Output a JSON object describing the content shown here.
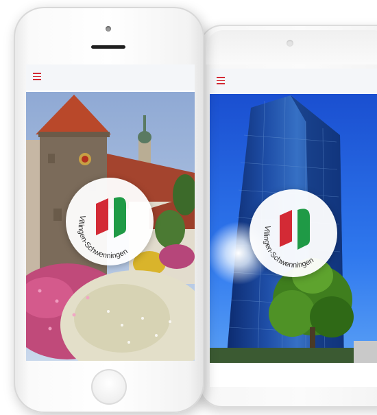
{
  "brand": {
    "logo_text": "Villingen-Schwenningen",
    "colors": {
      "red": "#d32a35",
      "green": "#1f9a46",
      "appbar": "#f4f6f9"
    }
  },
  "phones": [
    {
      "device": "iphone",
      "menu_icon": "hamburger-menu-icon",
      "photo": "historic gate tower with flower bed"
    },
    {
      "device": "android",
      "menu_icon": "hamburger-menu-icon",
      "photo": "glass high-rise tower against blue sky"
    }
  ]
}
